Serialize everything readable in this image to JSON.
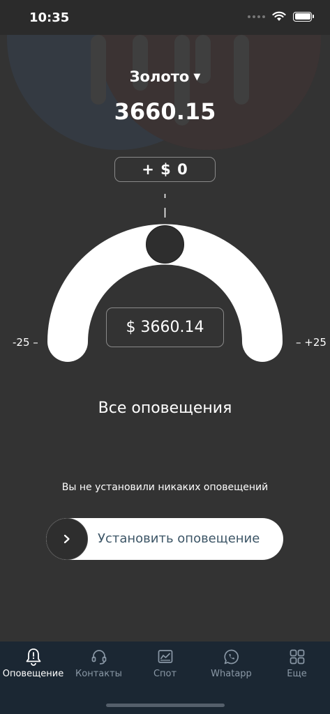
{
  "status_bar": {
    "time": "10:35"
  },
  "header": {
    "asset_name": "Золото",
    "price": "3660.15"
  },
  "offset": {
    "text": "+ $ 0"
  },
  "gauge": {
    "target_price": "$ 3660.14",
    "min_label": "-25 –",
    "max_label": "– +25",
    "position": 0.5
  },
  "alerts": {
    "title": "Все оповещения",
    "empty_text": "Вы не установили никаких оповещений",
    "set_button_label": "Установить оповещение"
  },
  "tabs": [
    {
      "label": "Оповещение",
      "icon": "bell-icon",
      "active": true
    },
    {
      "label": "Контакты",
      "icon": "headset-icon",
      "active": false
    },
    {
      "label": "Спот",
      "icon": "chart-icon",
      "active": false
    },
    {
      "label": "Whatapp",
      "icon": "whatsapp-icon",
      "active": false
    },
    {
      "label": "Еще",
      "icon": "grid-icon",
      "active": false
    }
  ],
  "colors": {
    "background": "#333333",
    "tab_bar": "#1b2733",
    "tab_inactive": "#8a98a6",
    "button_text": "#3c5566"
  }
}
